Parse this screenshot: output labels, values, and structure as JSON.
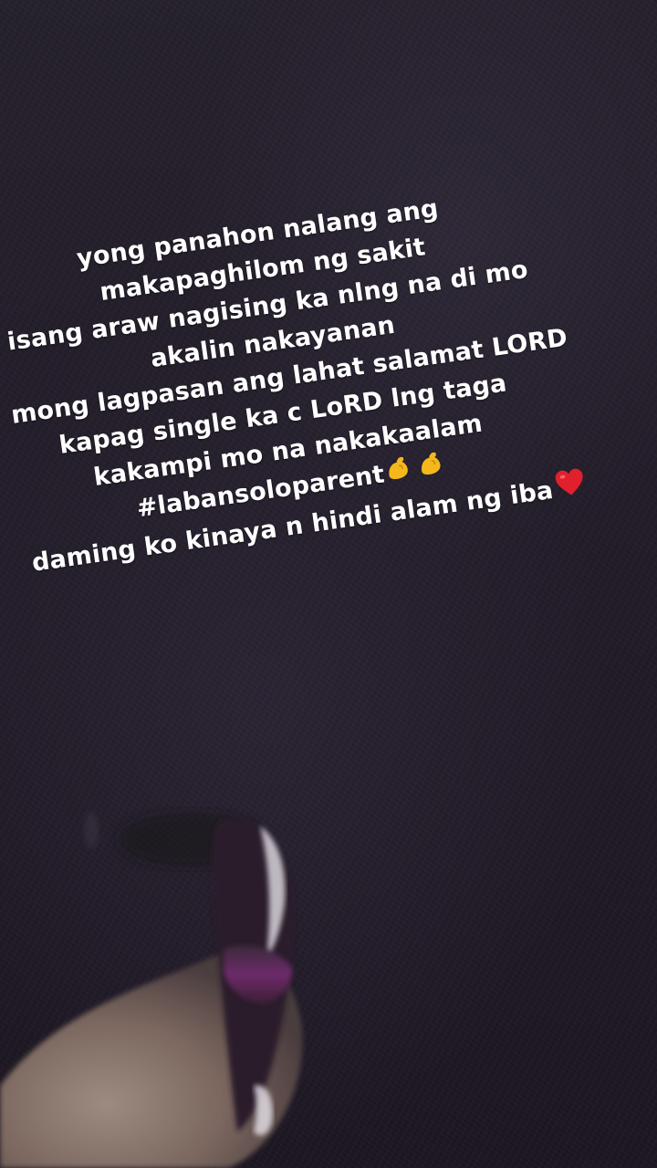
{
  "caption": {
    "lines": [
      "yong panahon nalang ang",
      "makapaghilom ng sakit",
      "isang araw nagising ka nlng na di mo",
      "akalin nakayanan",
      "mong lagpasan ang lahat salamat LORD",
      "kapag single ka c LoRD lng taga",
      "kakampi mo na nakakaalam",
      "#labansoloparent",
      "daming ko kinaya n hindi alam ng iba"
    ],
    "hashtag_emoji": "flexed-biceps-emoji x2",
    "last_line_emoji": "red-heart-emoji"
  },
  "colors": {
    "background": "#221c29",
    "text": "#ffffff",
    "emoji_biceps": "#f5b81c",
    "emoji_heart": "#e0202c",
    "shoe_accent": "#7a2a78"
  }
}
